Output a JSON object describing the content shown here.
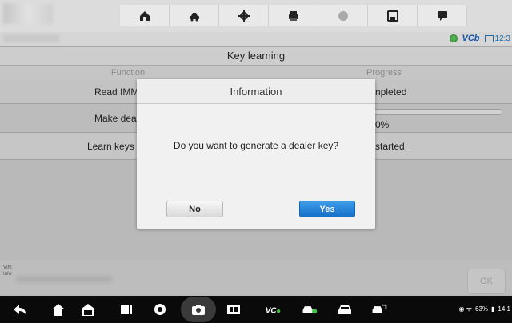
{
  "toolbar": {
    "buttons": [
      {
        "name": "home-icon"
      },
      {
        "name": "vehicle-swap-icon"
      },
      {
        "name": "settings-icon"
      },
      {
        "name": "print-icon"
      },
      {
        "name": "help-icon"
      },
      {
        "name": "save-icon"
      },
      {
        "name": "data-logging-icon"
      }
    ]
  },
  "status": {
    "vcb": "VCb",
    "time": "12:3"
  },
  "function": {
    "title": "Key learning",
    "col_function": "Function",
    "col_progress": "Progress",
    "rows": [
      {
        "function": "Read IMM",
        "progress": "npleted"
      },
      {
        "function": "Make dea",
        "progress": "0%",
        "progress_bar": 0
      },
      {
        "function": "Learn keys to",
        "progress": "started"
      }
    ]
  },
  "vin": {
    "vin_label": "VIN:",
    "info_label": "Info:"
  },
  "ok_label": "OK",
  "dialog": {
    "title": "Information",
    "message": "Do you want to generate a dealer key?",
    "no_label": "No",
    "yes_label": "Yes"
  },
  "navbar": {
    "battery": "63%",
    "time": "14:1"
  },
  "colors": {
    "accent": "#1570c9",
    "toolbar_bg": "#dcdcdc",
    "nav_bg": "#0a0a0a"
  }
}
